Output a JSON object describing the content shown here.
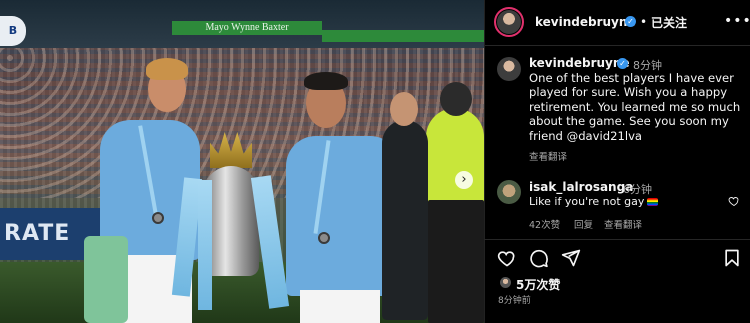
{
  "photo": {
    "stadium_banner": "Mayo Wynne Baxter",
    "ad_board_text": "RATE",
    "crest_text": "B",
    "carousel_next": "›"
  },
  "header": {
    "username": "kevindebruyne",
    "verified": "✓",
    "separator": "•",
    "follow_status": "已关注",
    "more": "•••"
  },
  "caption": {
    "username": "kevindebruyne",
    "verified": "✓",
    "time": "8分钟",
    "text": "One of the best players I have ever\nplayed for sure. Wish you a happy\nretirement. You learned me so much\nabout the game. See you soon my\nfriend @david21lva",
    "translate": "查看翻译"
  },
  "comment": {
    "username": "isak_lalrosanga",
    "time": "6分钟",
    "text": "Like if you're not gay",
    "likes": "42次赞",
    "reply": "回复",
    "translate": "查看翻译"
  },
  "footer": {
    "likes": "5万次赞",
    "posted": "8分钟前"
  },
  "colors": {
    "background": "#000000",
    "verified": "#3897f0",
    "muted_text": "#a8a8a8",
    "story_ring": "#e1306c",
    "city_blue": "#6cabdd"
  }
}
